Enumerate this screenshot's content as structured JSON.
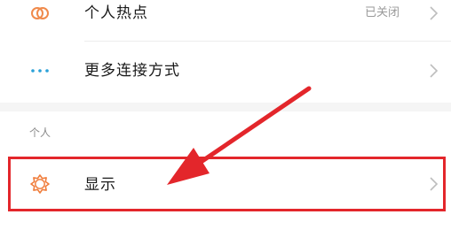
{
  "settings": {
    "rows": [
      {
        "label": "个人热点",
        "status": "已关闭",
        "icon": "hotspot-icon"
      },
      {
        "label": "更多连接方式",
        "icon": "more-dots-icon"
      }
    ],
    "personal_section": {
      "header": "个人",
      "rows": [
        {
          "label": "显示",
          "icon": "display-brightness-icon"
        }
      ]
    }
  },
  "colors": {
    "hotspot_icon": "#f08a4b",
    "dots_icon": "#2aa1d8",
    "display_icon": "#f07c3a",
    "annotation_red": "#e3262b",
    "chevron": "#bdbdbd"
  }
}
